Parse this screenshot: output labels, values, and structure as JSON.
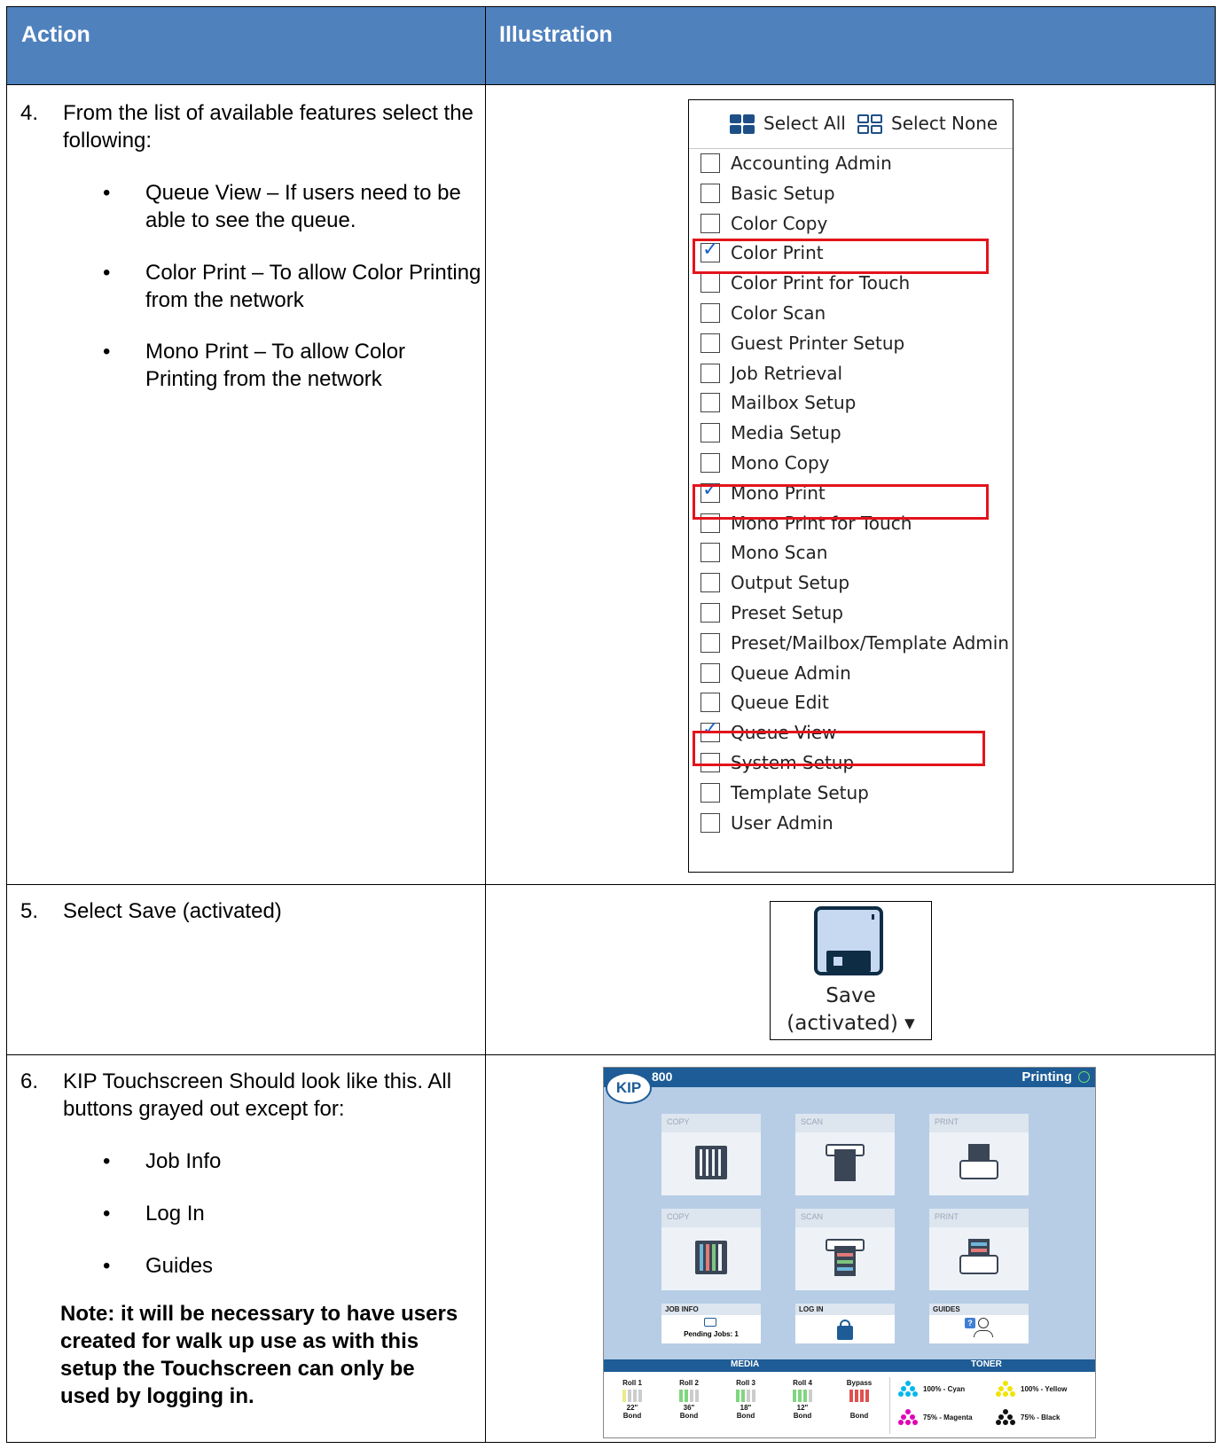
{
  "header": {
    "action": "Action",
    "illustration": "Illustration"
  },
  "steps": [
    {
      "num": "4.",
      "text": "From the list of available features select the following:",
      "bullets": [
        "Queue View – If users need to be able to see the queue.",
        "Color Print – To allow Color Printing from the network",
        "Mono Print – To allow Color Printing from the network"
      ]
    },
    {
      "num": "5.",
      "text": "Select Save (activated)"
    },
    {
      "num": "6.",
      "text": "KIP Touchscreen Should look like this. All buttons grayed out except for:",
      "bullets": [
        "Job Info",
        "Log In",
        "Guides"
      ],
      "note": "Note: it will be necessary to have users created for walk up use as with this setup the Touchscreen can only be used by logging in."
    }
  ],
  "features": {
    "select_all": "Select All",
    "select_none": "Select None",
    "items": [
      {
        "label": "Accounting Admin",
        "checked": false
      },
      {
        "label": "Basic Setup",
        "checked": false
      },
      {
        "label": "Color Copy",
        "checked": false
      },
      {
        "label": "Color Print",
        "checked": true
      },
      {
        "label": "Color Print for Touch",
        "checked": false
      },
      {
        "label": "Color Scan",
        "checked": false
      },
      {
        "label": "Guest Printer Setup",
        "checked": false
      },
      {
        "label": "Job Retrieval",
        "checked": false
      },
      {
        "label": "Mailbox Setup",
        "checked": false
      },
      {
        "label": "Media Setup",
        "checked": false
      },
      {
        "label": "Mono Copy",
        "checked": false
      },
      {
        "label": "Mono Print",
        "checked": true
      },
      {
        "label": "Mono Print for Touch",
        "checked": false
      },
      {
        "label": "Mono Scan",
        "checked": false
      },
      {
        "label": "Output Setup",
        "checked": false
      },
      {
        "label": "Preset Setup",
        "checked": false
      },
      {
        "label": "Preset/Mailbox/Template Admin",
        "checked": false
      },
      {
        "label": "Queue Admin",
        "checked": false
      },
      {
        "label": "Queue Edit",
        "checked": false
      },
      {
        "label": "Queue View",
        "checked": true
      },
      {
        "label": "System Setup",
        "checked": false
      },
      {
        "label": "Template Setup",
        "checked": false
      },
      {
        "label": "User Admin",
        "checked": false
      }
    ]
  },
  "save": {
    "line1": "Save",
    "line2": "(activated) ▾"
  },
  "kip": {
    "logo": "KIP",
    "model": "800",
    "status": "Printing",
    "tiles": [
      "COPY",
      "SCAN",
      "PRINT",
      "COPY",
      "SCAN",
      "PRINT"
    ],
    "small_tiles": [
      {
        "label": "JOB INFO",
        "sub": "Pending Jobs: 1"
      },
      {
        "label": "LOG IN",
        "sub": ""
      },
      {
        "label": "GUIDES",
        "sub": ""
      }
    ],
    "media_label": "MEDIA",
    "toner_label": "TONER",
    "rolls": [
      {
        "name": "Roll 1",
        "size": "22\"",
        "media": "Bond"
      },
      {
        "name": "Roll 2",
        "size": "36\"",
        "media": "Bond"
      },
      {
        "name": "Roll 3",
        "size": "18\"",
        "media": "Bond"
      },
      {
        "name": "Roll 4",
        "size": "12\"",
        "media": "Bond"
      },
      {
        "name": "Bypass",
        "size": "",
        "media": "Bond"
      }
    ],
    "toner": [
      {
        "label": "100% - Cyan",
        "color": "#00b7ea"
      },
      {
        "label": "100% - Yellow",
        "color": "#f0e400"
      },
      {
        "label": "75% - Magenta",
        "color": "#e200b5"
      },
      {
        "label": "75% - Black",
        "color": "#111111"
      }
    ]
  }
}
